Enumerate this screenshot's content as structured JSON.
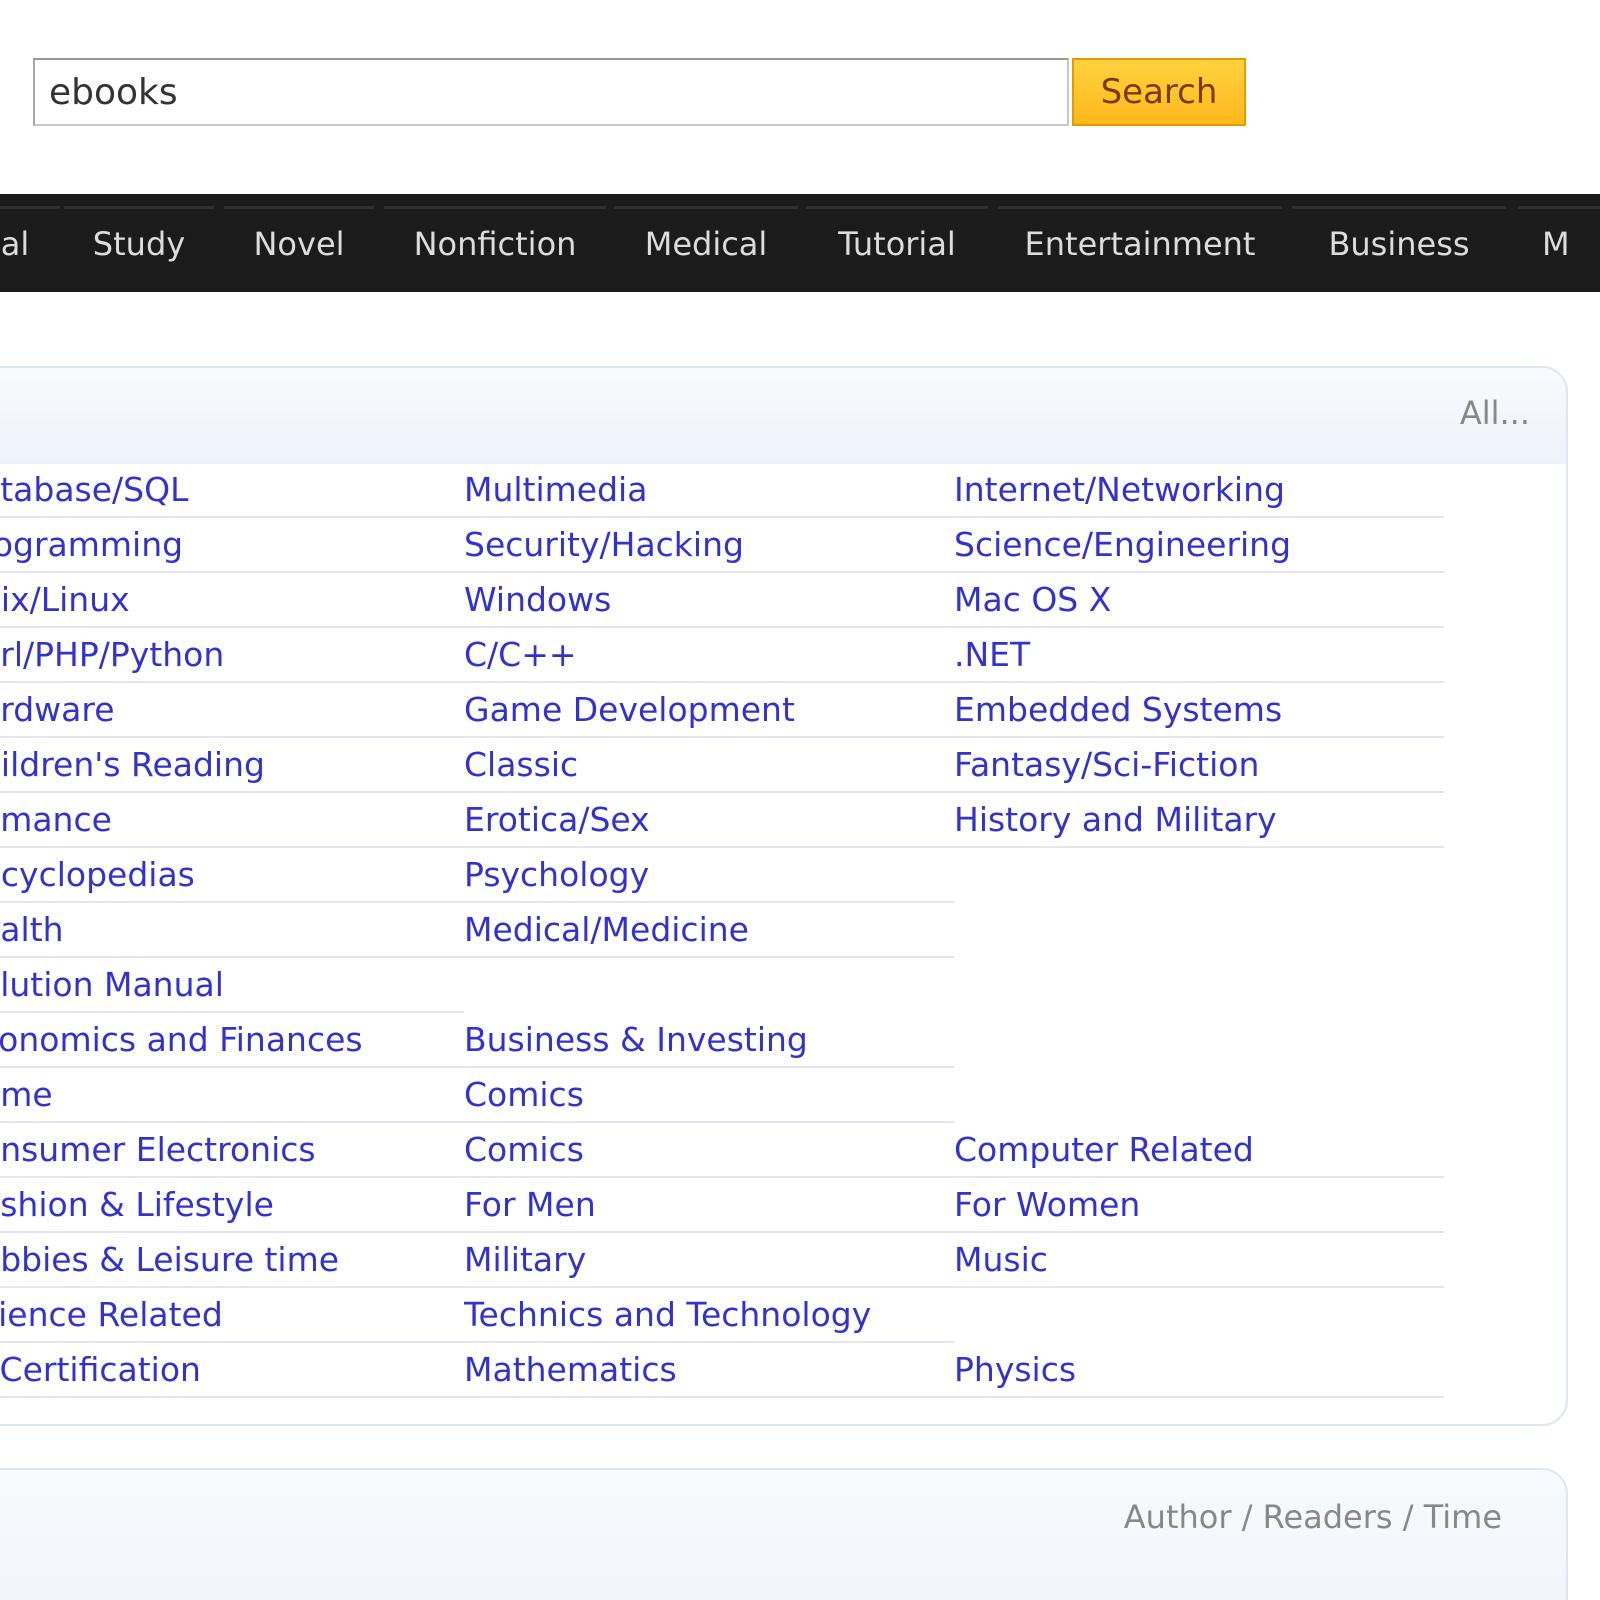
{
  "search": {
    "value": "ebooks",
    "button_label": "Search",
    "button_color": "#ffc125"
  },
  "nav": {
    "items": [
      {
        "label": "al"
      },
      {
        "label": "Study"
      },
      {
        "label": "Novel"
      },
      {
        "label": "Nonfiction"
      },
      {
        "label": "Medical"
      },
      {
        "label": "Tutorial"
      },
      {
        "label": "Entertainment"
      },
      {
        "label": "Business"
      },
      {
        "label": "M"
      }
    ]
  },
  "categories": {
    "all_link": "All...",
    "link_color": "#3333cc",
    "rows": [
      [
        "atabase/SQL",
        "Multimedia",
        "Internet/Networking"
      ],
      [
        "rogramming",
        "Security/Hacking",
        "Science/Engineering"
      ],
      [
        "nix/Linux",
        "Windows",
        "Mac OS X"
      ],
      [
        "erl/PHP/Python",
        "C/C++",
        ".NET"
      ],
      [
        "ardware",
        "Game Development",
        "Embedded Systems"
      ],
      [
        "hildren's Reading",
        "Classic",
        "Fantasy/Sci-Fiction"
      ],
      [
        "omance",
        "Erotica/Sex",
        "History and Military"
      ],
      [
        "ncyclopedias",
        "Psychology",
        ""
      ],
      [
        "ealth",
        "Medical/Medicine",
        ""
      ],
      [
        "olution Manual",
        "",
        ""
      ],
      [
        "conomics and Finances",
        "Business & Investing",
        ""
      ],
      [
        "ame",
        "Comics",
        ""
      ],
      [
        "onsumer Electronics",
        "Comics",
        "Computer Related"
      ],
      [
        "ashion & Lifestyle",
        "For Men",
        "For Women"
      ],
      [
        "obbies & Leisure time",
        "Military",
        "Music"
      ],
      [
        "cience Related",
        "Technics and Technology",
        ""
      ],
      [
        "' Certification",
        "Mathematics",
        "Physics"
      ]
    ]
  },
  "list_panel": {
    "header_label": "Author / Readers / Time"
  }
}
